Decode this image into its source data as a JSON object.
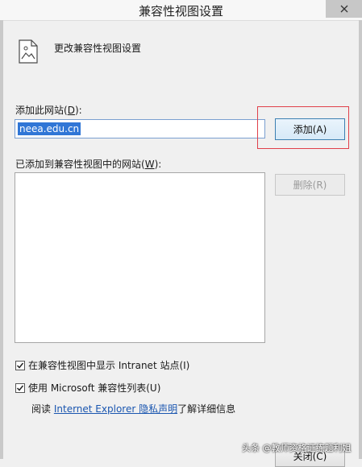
{
  "window": {
    "title": "兼容性视图设置",
    "close_icon": "close-icon"
  },
  "header": {
    "text": "更改兼容性视图设置",
    "icon": "document-icon"
  },
  "add_site": {
    "label_prefix": "添加此网站(",
    "label_key": "D",
    "label_suffix": "):",
    "value": "neea.edu.cn",
    "add_button": "添加(A)"
  },
  "added_sites": {
    "label_prefix": "已添加到兼容性视图中的网站(",
    "label_key": "W",
    "label_suffix": "):",
    "items": [],
    "remove_button": "删除(R)"
  },
  "options": {
    "intranet": {
      "checked": true,
      "label": "在兼容性视图中显示 Intranet 站点(I)"
    },
    "ms_list": {
      "checked": true,
      "label": "使用 Microsoft 兼容性列表(U)"
    }
  },
  "privacy": {
    "prefix": "阅读",
    "link": "Internet Explorer 隐私声明",
    "suffix": "了解详细信息"
  },
  "footer": {
    "close_button": "关闭(C)"
  },
  "watermark": "头条 @教师资格证练题利姐",
  "colors": {
    "highlight": "#e0404a",
    "selection": "#3076d6",
    "link": "#1a56b0"
  }
}
